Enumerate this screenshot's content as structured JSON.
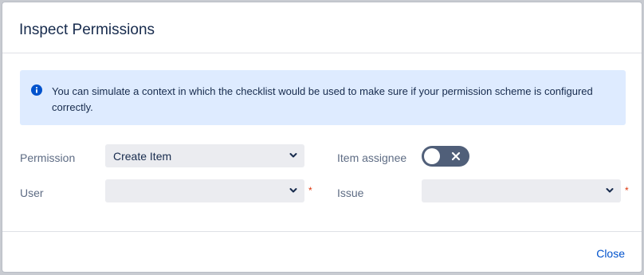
{
  "dialog": {
    "title": "Inspect Permissions"
  },
  "info": {
    "message": "You can simulate a context in which the checklist would be used to make sure if your permission scheme is configured correctly."
  },
  "form": {
    "permission_label": "Permission",
    "permission_value": "Create Item",
    "user_label": "User",
    "user_value": "",
    "item_assignee_label": "Item assignee",
    "item_assignee_on": false,
    "issue_label": "Issue",
    "issue_value": "",
    "required_marker": "*"
  },
  "footer": {
    "close_label": "Close"
  },
  "colors": {
    "accent": "#0052cc",
    "info_bg": "#deebff",
    "toggle_off": "#505f79",
    "required": "#de350b"
  },
  "icons": {
    "info": "info-icon",
    "chevron": "chevron-down-icon",
    "toggle_x": "close-icon"
  }
}
